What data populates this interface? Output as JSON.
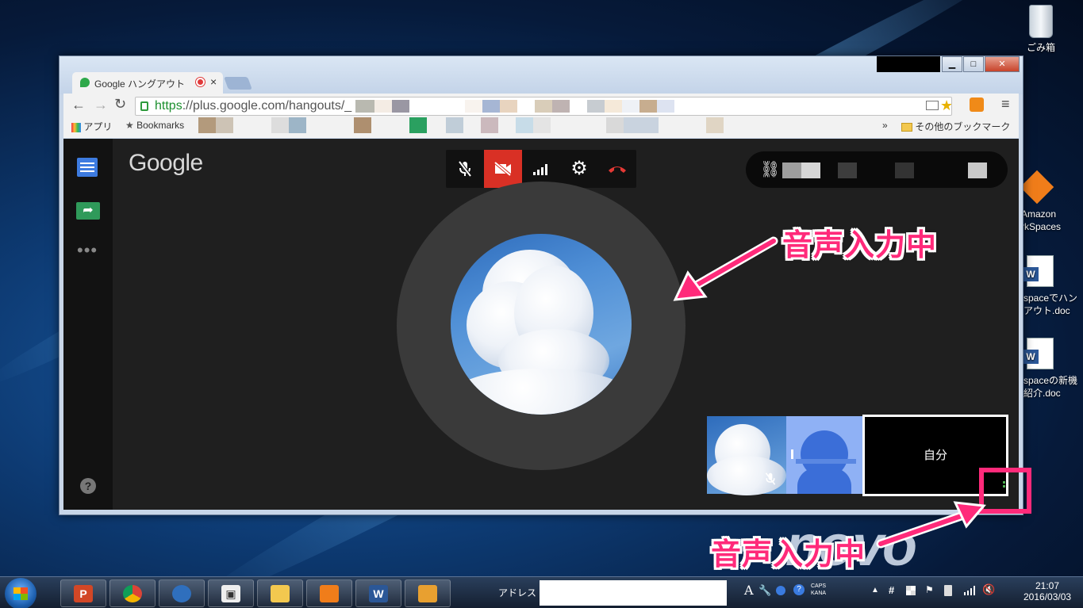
{
  "desktop": {
    "icons": [
      {
        "label": "ごみ箱"
      },
      {
        "label_line1": "Amazon",
        "label_line2": "rkSpaces"
      },
      {
        "label_line1": "spaceでハン",
        "label_line2": "アウト.doc"
      },
      {
        "label_line1": "spaceの新機",
        "label_line2": "紹介.doc"
      }
    ]
  },
  "browser": {
    "tab_title": "Google ハングアウト",
    "tab_close": "×",
    "url_https": "https",
    "url_rest": "://plus.google.com/hangouts/_",
    "bookmarks": {
      "apps": "アプリ",
      "bookmarks": "Bookmarks",
      "more": "»",
      "other": "その他のブックマーク"
    },
    "window_controls": {
      "minimize": "▁",
      "maximize": "□",
      "close": "✕"
    }
  },
  "hangouts": {
    "logo": "Google",
    "self_label": "自分",
    "controls": [
      "mic-off",
      "video-off",
      "signal",
      "settings",
      "hangup"
    ],
    "link_icon": "link-icon"
  },
  "annotations": {
    "top": "音声入力中",
    "bottom": "音声入力中"
  },
  "taskbar": {
    "address_label": "アドレス",
    "time": "21:07",
    "date": "2016/03/03",
    "caps": "CAPS",
    "kana": "KANA",
    "ime": "A"
  },
  "colors": {
    "accent_red": "#d93025",
    "annotation_pink": "#ff2a7a",
    "hangouts_bg": "#1f1f1f"
  }
}
